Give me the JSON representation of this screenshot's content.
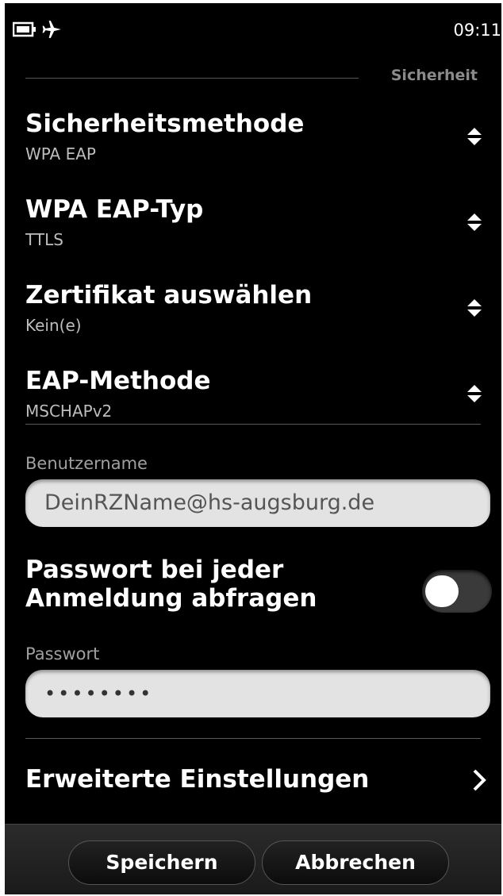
{
  "status": {
    "time": "09:11",
    "icons": [
      "battery-icon",
      "airplane-mode-icon"
    ]
  },
  "section": {
    "title": "Sicherheit"
  },
  "settings": [
    {
      "label": "Sicherheitsmethode",
      "value": "WPA EAP"
    },
    {
      "label": "WPA EAP-Typ",
      "value": "TTLS"
    },
    {
      "label": "Zertifikat auswählen",
      "value": "Kein(e)"
    },
    {
      "label": "EAP-Methode",
      "value": "MSCHAPv2"
    }
  ],
  "username": {
    "label": "Benutzername",
    "value": "DeinRZName@hs-augsburg.de"
  },
  "password_prompt": {
    "label": "Passwort bei jeder Anmeldung abfragen",
    "enabled": false
  },
  "password": {
    "label": "Passwort",
    "value": "••••••••"
  },
  "advanced": {
    "label": "Erweiterte Einstellungen"
  },
  "actions": {
    "save": "Speichern",
    "cancel": "Abbrechen"
  },
  "colors": {
    "background": "#000000",
    "field": "#e3e3e3",
    "section_title": "#8a8a8a"
  }
}
